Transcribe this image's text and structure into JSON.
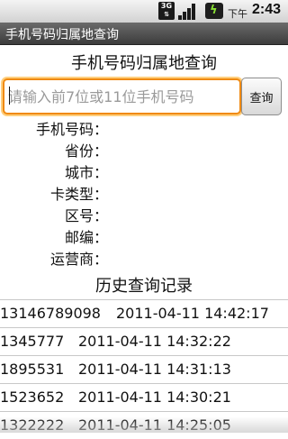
{
  "status_bar": {
    "network": "3G",
    "am_pm": "下午",
    "time": "2:43",
    "icons": [
      "network-3g-icon",
      "signal-strength-icon",
      "battery-charging-icon"
    ]
  },
  "app": {
    "title": "手机号码归属地查询"
  },
  "main": {
    "heading": "手机号码归属地查询",
    "search": {
      "value": "",
      "placeholder": "请输入前7位或11位手机号码",
      "button_label": "查询"
    },
    "fields": [
      {
        "label": "手机号码：",
        "value": ""
      },
      {
        "label": "省份：",
        "value": ""
      },
      {
        "label": "城市：",
        "value": ""
      },
      {
        "label": "卡类型：",
        "value": ""
      },
      {
        "label": "区号：",
        "value": ""
      },
      {
        "label": "邮编：",
        "value": ""
      },
      {
        "label": "运营商：",
        "value": ""
      }
    ]
  },
  "history": {
    "title": "历史查询记录",
    "records": [
      {
        "number": "13146789098",
        "datetime": "2011-04-11 14:42:17"
      },
      {
        "number": "1345777",
        "datetime": "2011-04-11 14:32:22"
      },
      {
        "number": "1895531",
        "datetime": "2011-04-11 14:31:13"
      },
      {
        "number": "1523652",
        "datetime": "2011-04-11 14:30:21"
      },
      {
        "number": "1322222",
        "datetime": "2011-04-11 14:25:05"
      }
    ]
  },
  "colors": {
    "focus_border": "#f08a12",
    "title_bar": "#4a4a4a",
    "battery_bolt": "#8ae234"
  }
}
